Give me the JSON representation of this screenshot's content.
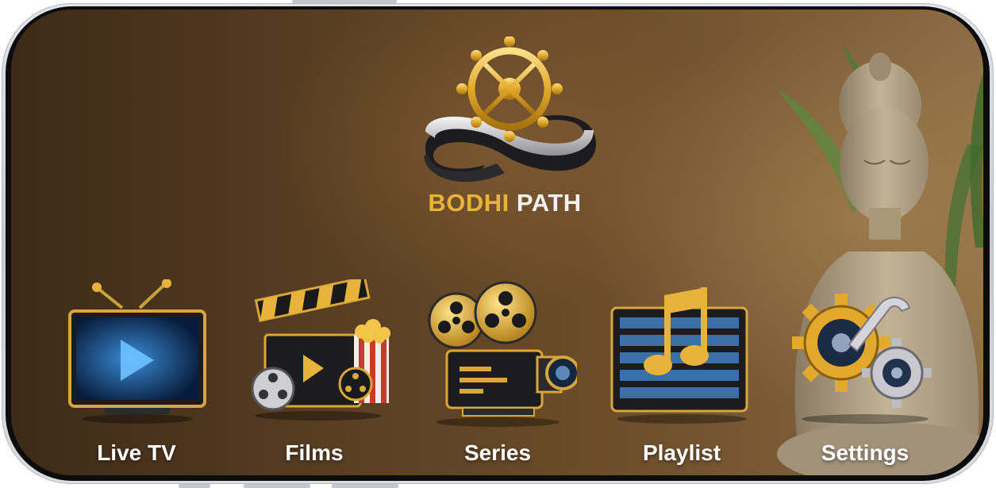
{
  "app": {
    "logo_word1": "BODHI",
    "logo_word2": "PATH"
  },
  "menu": [
    {
      "id": "live-tv",
      "label": "Live TV",
      "icon": "tv-icon"
    },
    {
      "id": "films",
      "label": "Films",
      "icon": "clapperboard-icon"
    },
    {
      "id": "series",
      "label": "Series",
      "icon": "film-projector-icon"
    },
    {
      "id": "playlist",
      "label": "Playlist",
      "icon": "music-note-icon"
    },
    {
      "id": "settings",
      "label": "Settings",
      "icon": "gears-wrench-icon"
    }
  ],
  "colors": {
    "gold": "#e8b33a",
    "background": "#5a3f22"
  }
}
